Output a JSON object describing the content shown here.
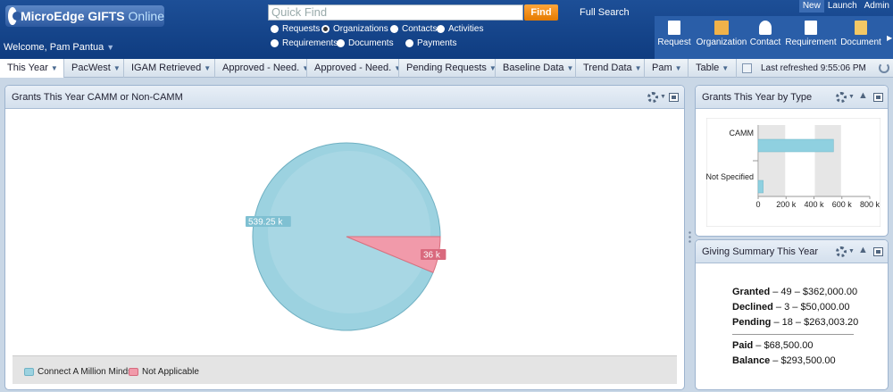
{
  "app": {
    "logo_main": "MicroEdge GIFTS",
    "logo_online": "Online",
    "welcome": "Welcome, Pam Pantua"
  },
  "search": {
    "placeholder": "Quick Find",
    "find_label": "Find",
    "full_search_label": "Full Search",
    "options": [
      "Requests",
      "Organizations",
      "Contacts",
      "Activities",
      "Requirements",
      "Documents",
      "Payments"
    ],
    "selected": "Organizations"
  },
  "topnav": [
    "New",
    "Launch",
    "Admin"
  ],
  "quick_create": [
    "Request",
    "Organization",
    "Contact",
    "Requirement",
    "Document"
  ],
  "tabs": [
    {
      "label": "This Year"
    },
    {
      "label": "PacWest"
    },
    {
      "label": "IGAM Retrieved"
    },
    {
      "label": "Approved - Need."
    },
    {
      "label": "Approved - Need."
    },
    {
      "label": "Pending Requests"
    },
    {
      "label": "Baseline Data"
    },
    {
      "label": "Trend Data"
    },
    {
      "label": "Pam"
    },
    {
      "label": "Table"
    }
  ],
  "refresh_text": "Last refreshed 9:55:06 PM",
  "panels": {
    "camm": {
      "title": "Grants This Year CAMM or Non-CAMM",
      "legend": [
        "Connect A Million Minds",
        "Not Applicable"
      ]
    },
    "by_type": {
      "title": "Grants This Year by Type"
    },
    "summary": {
      "title": "Giving Summary This Year",
      "lines": [
        {
          "label": "Granted",
          "value": "– 49 – $362,000.00"
        },
        {
          "label": "Declined",
          "value": "– 3 – $50,000.00"
        },
        {
          "label": "Pending",
          "value": "– 18 – $263,003.20"
        },
        {
          "label": "Paid",
          "value": "– $68,500.00"
        },
        {
          "label": "Balance",
          "value": "– $293,500.00"
        }
      ]
    }
  },
  "colors": {
    "pie_main": "#9cd2e0",
    "pie_other": "#f19aaa",
    "bar": "#8fd0e0"
  },
  "chart_data": [
    {
      "type": "pie",
      "categories": [
        "Connect A Million Minds",
        "Not Applicable"
      ],
      "values": [
        539250,
        36000
      ],
      "data_labels": [
        "539.25 k",
        "36 k"
      ],
      "legend": "bottom-left"
    },
    {
      "type": "bar",
      "orientation": "horizontal",
      "categories": [
        "CAMM",
        "Not Specified"
      ],
      "values": [
        540000,
        36000
      ],
      "xlim": [
        0,
        800000
      ],
      "xticks": [
        "0",
        "200 k",
        "400 k",
        "600 k",
        "800 k"
      ]
    }
  ]
}
